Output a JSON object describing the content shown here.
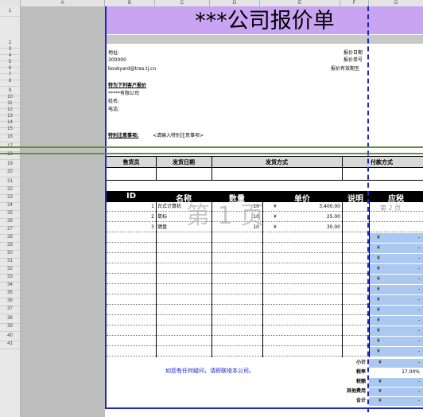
{
  "columns": [
    "A",
    "B",
    "C",
    "D",
    "E",
    "F",
    "G"
  ],
  "rows": [
    "1",
    "2",
    "3",
    "4",
    "5",
    "6",
    "7",
    "8",
    "9",
    "10",
    "11",
    "12",
    "13",
    "14",
    "15",
    "16",
    "17",
    "18",
    "19",
    "20",
    "21",
    "22",
    "23",
    "24",
    "25",
    "26",
    "27",
    "28",
    "29",
    "30",
    "31",
    "32",
    "33",
    "34",
    "35",
    "36",
    "37",
    "38",
    "39",
    "40",
    "41"
  ],
  "title": "***公司报价单",
  "left_info": {
    "address": "地址:",
    "zip": "300000",
    "email": "bookyard@tres.tj.cn"
  },
  "right_info": {
    "date": "报价日期",
    "no": "报价单号",
    "valid": "报价有效期至"
  },
  "client": {
    "heading": "特为下列客户报价",
    "company": "*****有限公司",
    "name": "姓名:",
    "phone": "电话:"
  },
  "notes": {
    "label": "特别注意事项:",
    "text": "<请输入特别注意事项>"
  },
  "ship_headers": [
    "售货员",
    "发货日期",
    "发货方式",
    "付款方式"
  ],
  "item_headers": [
    "ID",
    "名称",
    "数量",
    "单价",
    "说明",
    "应税"
  ],
  "items": [
    {
      "id": "1",
      "name": "台式计算机",
      "qty": "10",
      "cur": "¥",
      "price": "3,400.00"
    },
    {
      "id": "2",
      "name": "鼠标",
      "qty": "10",
      "cur": "¥",
      "price": "25.00"
    },
    {
      "id": "3",
      "name": "键盘",
      "qty": "10",
      "cur": "¥",
      "price": "30.00"
    }
  ],
  "blank_rows_g": [
    {
      "cur": "¥",
      "val": "-"
    },
    {
      "cur": "¥",
      "val": "-"
    },
    {
      "cur": "¥",
      "val": "-"
    },
    {
      "cur": "¥",
      "val": "-"
    },
    {
      "cur": "¥",
      "val": "-"
    },
    {
      "cur": "¥",
      "val": "-"
    },
    {
      "cur": "¥",
      "val": "-"
    },
    {
      "cur": "¥",
      "val": "-"
    },
    {
      "cur": "¥",
      "val": "-"
    },
    {
      "cur": "¥",
      "val": "-"
    },
    {
      "cur": "¥",
      "val": "-"
    },
    {
      "cur": "¥",
      "val": "-"
    }
  ],
  "watermark1": "第 1 页",
  "watermark2": "第 2 页",
  "contact": "如您有任何疑问，请即联络本公司。",
  "totals": [
    {
      "label": "小计",
      "cur": "¥",
      "val": "-"
    },
    {
      "label": "税率",
      "cur": "",
      "val": "17.00%"
    },
    {
      "label": "税额",
      "cur": "¥",
      "val": "-"
    },
    {
      "label": "其他费用",
      "cur": "¥",
      "val": "-"
    },
    {
      "label": "合计",
      "cur": "¥",
      "val": "-"
    }
  ]
}
